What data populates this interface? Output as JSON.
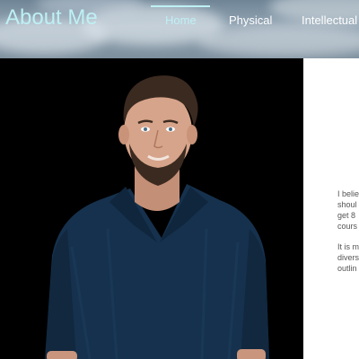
{
  "header": {
    "site_title": "About Me",
    "nav": [
      {
        "label": "Home",
        "active": true
      },
      {
        "label": "Physical",
        "active": false
      },
      {
        "label": "Intellectual",
        "active": false
      }
    ]
  },
  "profile_photo": {
    "subject": "man with short dark hair and beard in a dark blue button-up shirt on a black background"
  },
  "body_text": {
    "paragraph_1_lines": [
      "I belie",
      "shoul",
      "get 8",
      "cours"
    ],
    "paragraph_2_lines": [
      "It is m",
      "divers",
      "outlin"
    ]
  },
  "colors": {
    "title_accent": "#bdf0f4",
    "nav_text": "#ffffff",
    "photo_background": "#000000",
    "shirt": "#16314d",
    "body_text": "#555555"
  }
}
